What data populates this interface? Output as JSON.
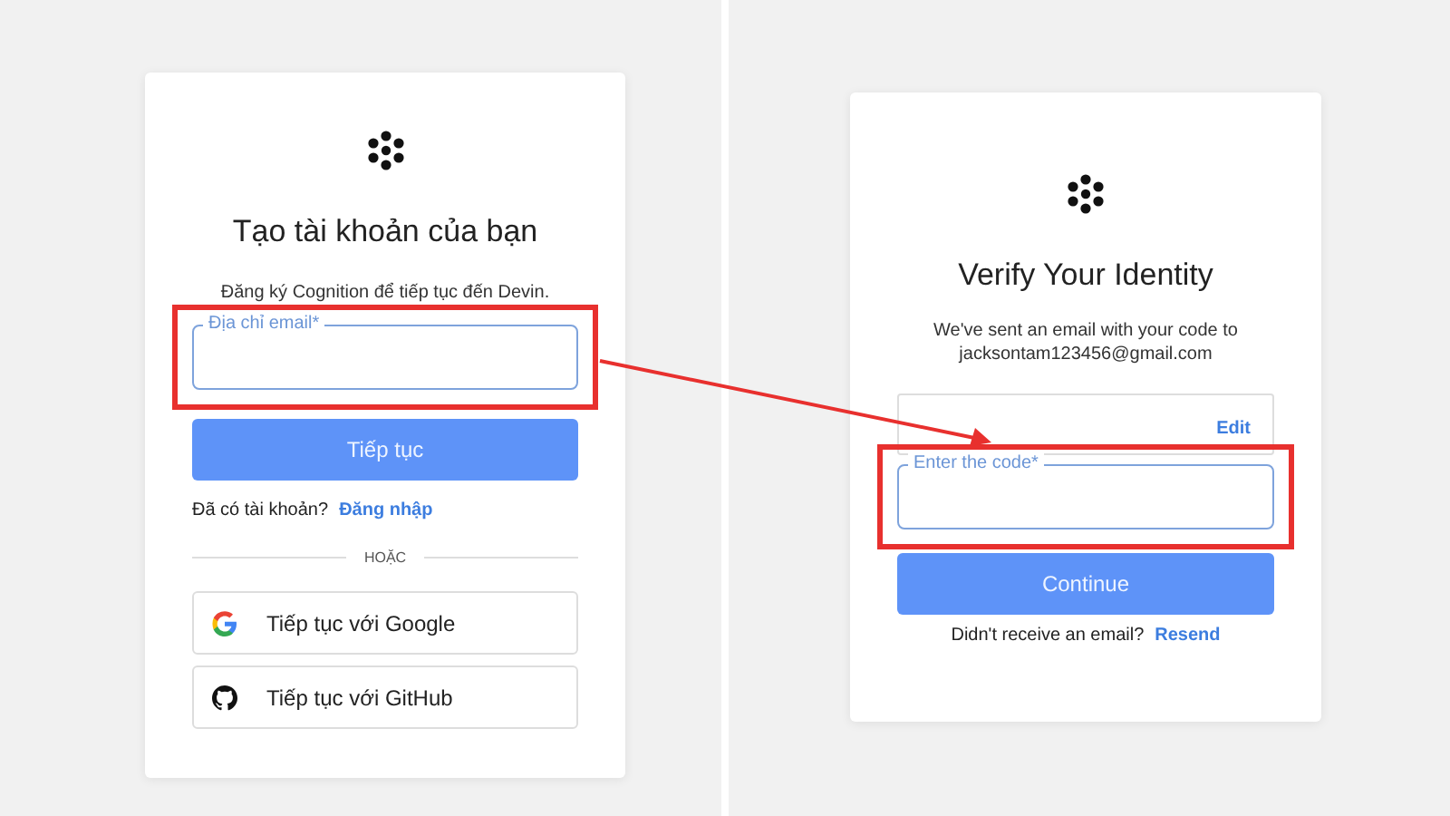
{
  "cards": [
    {
      "items": [
        {
          "kind": "logo"
        },
        {
          "kind": "heading",
          "text": "Tạo tài khoản của bạn"
        },
        {
          "kind": "subtitle",
          "text": "Đăng ký Cognition để tiếp tục đến Devin."
        },
        {
          "kind": "field",
          "label": "Địa chỉ email*",
          "highlighted": true
        },
        {
          "kind": "primary_button",
          "label": "Tiếp tục"
        },
        {
          "kind": "prompt",
          "text": "Đã có tài khoản?",
          "link": "Đăng nhập"
        },
        {
          "kind": "divider",
          "text": "HOẶC"
        },
        {
          "kind": "google_button",
          "label": "Tiếp tục với Google"
        },
        {
          "kind": "github_button",
          "label": "Tiếp tục với GitHub"
        }
      ]
    },
    {
      "items": [
        {
          "kind": "logo"
        },
        {
          "kind": "heading",
          "text": "Verify Your Identity"
        },
        {
          "kind": "subtitle",
          "text": "We've sent an email with your code to jacksontam123456@gmail.com"
        },
        {
          "kind": "email_box",
          "link": "Edit"
        },
        {
          "kind": "field",
          "label": "Enter the code*",
          "highlighted": true
        },
        {
          "kind": "primary_button",
          "label": "Continue"
        },
        {
          "kind": "prompt",
          "text": "Didn't receive an email?",
          "link": "Resend"
        }
      ]
    }
  ],
  "annotation": {
    "arrow": true
  }
}
